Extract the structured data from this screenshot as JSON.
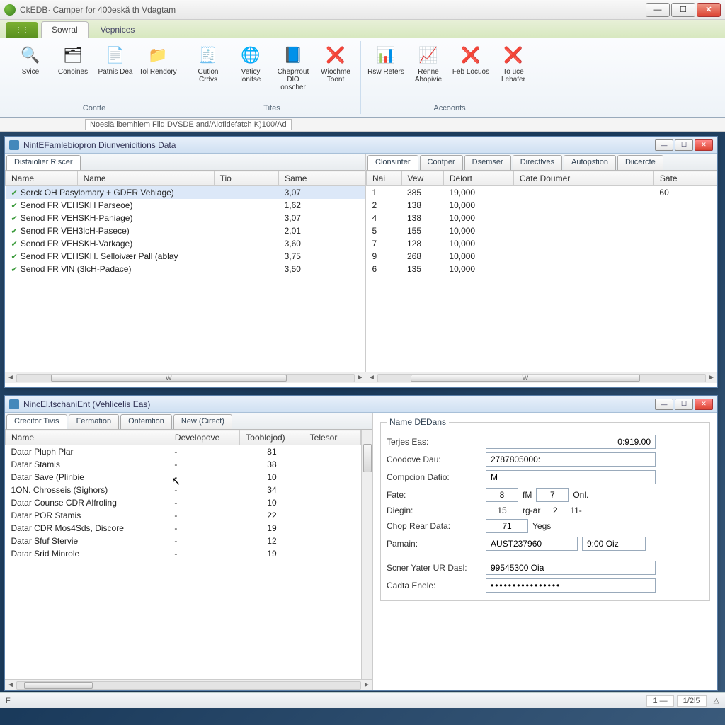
{
  "window": {
    "title": "CkEDB· Camper for 400eskǎ th Vdagtam"
  },
  "ribbon": {
    "tabs": [
      "Sowral",
      "Vepnices"
    ],
    "groups": [
      {
        "label": "Contte",
        "items": [
          {
            "icon": "🔍",
            "label": "Svice"
          },
          {
            "icon": "🗂",
            "label": "Conoines"
          },
          {
            "icon": "📄",
            "label": "Patnis Dea"
          },
          {
            "icon": "📁",
            "label": "Tol Rendory"
          }
        ]
      },
      {
        "label": "Tites",
        "items": [
          {
            "icon": "🧾",
            "label": "Cution Crdvs"
          },
          {
            "icon": "🌐",
            "label": "Veticy lonitse"
          },
          {
            "icon": "📘",
            "label": "Cheprrout DlO onscher"
          },
          {
            "icon": "❌",
            "label": "Wiochme Toont"
          }
        ]
      },
      {
        "label": "Accoonts",
        "items": [
          {
            "icon": "📊",
            "label": "Rsw Reters"
          },
          {
            "icon": "📈",
            "label": "Renne Abopivie"
          },
          {
            "icon": "❌",
            "label": "Feb Locuos"
          },
          {
            "icon": "❌",
            "label": "To uce Lebafer"
          }
        ]
      }
    ]
  },
  "breadcrumb": "Noeslä lbemhiem Fiid DVSDE and/Aiofidefatch K)100/Ad",
  "panelA": {
    "title": "NintEFamlebiopron Diunvenicitions Data",
    "tabsLeft": [
      "Distaiolier Riscer"
    ],
    "tabsRight": [
      "Clonsinter",
      "Contper",
      "Dsemser",
      "Directlves",
      "Autopstion",
      "Diicercte"
    ],
    "colsLeft": [
      "Name",
      "Name",
      "Tio",
      "Same"
    ],
    "rowsLeft": [
      {
        "name": "Serck OH Pasylomary + GDER Vehiage)",
        "same": "3,07",
        "sel": true
      },
      {
        "name": "Senod FR VEHSKH Parseoe)",
        "same": "1,62"
      },
      {
        "name": "Senod FR VEHSKH-Paniage)",
        "same": "3,07"
      },
      {
        "name": "Senod FR VEH3lcH-Pasece)",
        "same": "2,01"
      },
      {
        "name": "Senod FR VEHSKH-Varkage)",
        "same": "3,60"
      },
      {
        "name": "Senod FR VEHSKH. Selloivær Pall (ablay",
        "same": "3,75"
      },
      {
        "name": "Senod FR VlN (3lcH-Padace)",
        "same": "3,50"
      }
    ],
    "colsRight": [
      "Nai",
      "Vew",
      "Delort",
      "Cate Doumer",
      "Sate"
    ],
    "rowsRight": [
      {
        "c": [
          "1",
          "385",
          "19,000",
          "",
          "60"
        ]
      },
      {
        "c": [
          "2",
          "138",
          "10,000",
          "",
          ""
        ]
      },
      {
        "c": [
          "4",
          "138",
          "10,000",
          "",
          ""
        ]
      },
      {
        "c": [
          "5",
          "155",
          "10,000",
          "",
          ""
        ]
      },
      {
        "c": [
          "7",
          "128",
          "10,000",
          "",
          ""
        ]
      },
      {
        "c": [
          "9",
          "268",
          "10,000",
          "",
          ""
        ]
      },
      {
        "c": [
          "6",
          "135",
          "10,000",
          "",
          ""
        ]
      }
    ],
    "scrollLabel": "W"
  },
  "panelB": {
    "title": "NincEl.tschaniEnt (Vehlicelis Eas)",
    "tabs": [
      "Crecitor Tivis",
      "Fermation",
      "Ontemtion",
      "New (Cirect)"
    ],
    "cols": [
      "Name",
      "Developove",
      "Tooblojod)",
      "Telesor"
    ],
    "rows": [
      {
        "c": [
          "Datar Pluph Plar",
          "-",
          "81",
          ""
        ]
      },
      {
        "c": [
          "Datar Stamis",
          "-",
          "38",
          ""
        ]
      },
      {
        "c": [
          "Datar Save (Plinbie",
          "-",
          "10",
          ""
        ]
      },
      {
        "c": [
          "1ON. Chrosseis (Sighors)",
          "-",
          "34",
          ""
        ]
      },
      {
        "c": [
          "Datar Counse CDR Alfroling",
          "-",
          "10",
          ""
        ]
      },
      {
        "c": [
          "Datar POR Stamis",
          "-",
          "22",
          ""
        ]
      },
      {
        "c": [
          "Datar CDR Mos4Sds, Discore",
          "-",
          "19",
          ""
        ]
      },
      {
        "c": [
          "Datar Sfuf Stervie",
          "-",
          "12",
          ""
        ]
      },
      {
        "c": [
          "Datar Srid Minrole",
          "-",
          "19",
          ""
        ]
      }
    ],
    "form": {
      "legend": "Name DEDans",
      "fields": {
        "terjes": {
          "label": "Terjes Eas:",
          "value": "0:919.00"
        },
        "coodove": {
          "label": "Coodove Dau:",
          "value": "2787805000:"
        },
        "compcion": {
          "label": "Compcion Datio:",
          "value": "M"
        },
        "fate": {
          "label": "Fate:",
          "v1": "8",
          "u1": "fM",
          "v2": "7",
          "u2": "Onl."
        },
        "diegin": {
          "label": "Diegin:",
          "v1": "15",
          "u1": "rg-ar",
          "v2": "2",
          "u2": "11-"
        },
        "chop": {
          "label": "Chop Rear Data:",
          "v1": "71",
          "u1": "Yegs"
        },
        "pamain": {
          "label": "Pamain:",
          "v1": "AUST237960",
          "v2": "9:00 Oiz"
        },
        "scner": {
          "label": "Scner Yater UR Dasl:",
          "value": "99545300 Oia"
        },
        "cadta": {
          "label": "Cadta Enele:",
          "value": "••••••••••••••••"
        }
      }
    }
  },
  "status": {
    "left": "F",
    "page1": "1 —",
    "page2": "1/2l5",
    "tri": "△"
  }
}
